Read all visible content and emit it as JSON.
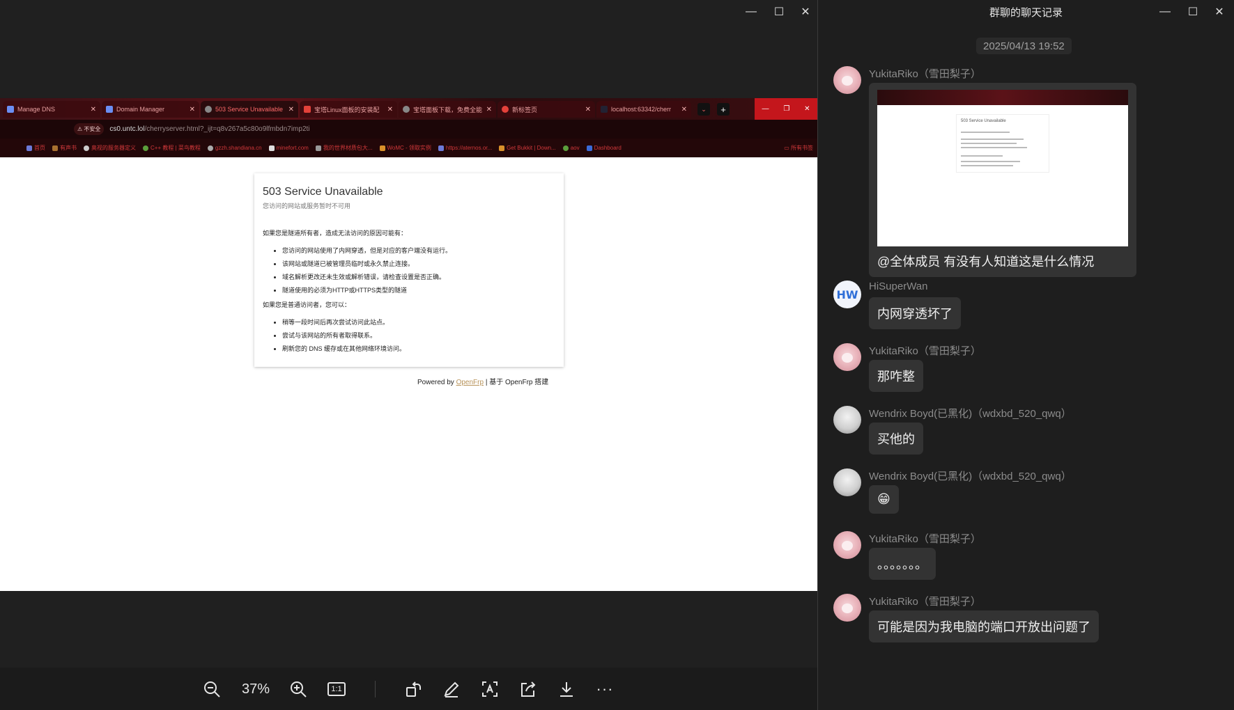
{
  "viewer": {
    "window_controls": {
      "minimize": "—",
      "maximize": "☐",
      "close": "✕"
    },
    "browser": {
      "tabs": [
        {
          "label": "Manage DNS",
          "active": false
        },
        {
          "label": "Domain Manager",
          "active": false
        },
        {
          "label": "503 Service Unavailable",
          "active": true
        },
        {
          "label": "宝塔Linux面板的安装配",
          "active": false
        },
        {
          "label": "宝塔面板下载，免费全能",
          "active": false
        },
        {
          "label": "新标签页",
          "active": false
        },
        {
          "label": "localhost:63342/cherr",
          "active": false
        }
      ],
      "security_label": "⚠ 不安全",
      "url_host": "cs0.untc.lol",
      "url_path": "/cherryserver.html?_ijt=q8v267a5c80o9lfmbdn7imp2ti",
      "bookmarks": [
        "首页",
        "有声书",
        "奥视的服务器定义",
        "C++ 教程 | 菜鸟教程",
        "gzzh.shandiana.cn",
        "minefort.com",
        "我的世界材质包大...",
        "WoMC - 领取实例",
        "https://aternos.or...",
        "Get Bukkit | Down...",
        "aov",
        "Dashboard"
      ],
      "bookmarks_all": "所有书签"
    },
    "page": {
      "title": "503 Service Unavailable",
      "subtitle": "您访问的网站或服务暂时不可用",
      "owner_intro": "如果您是隧道所有者，造成无法访问的原因可能有：",
      "owner_reasons": [
        "您访问的网站使用了内网穿透，但是对应的客户端没有运行。",
        "该网站或隧道已被管理员临时或永久禁止连接。",
        "域名解析更改还未生效或解析错误，请检查设置是否正确。",
        "隧道使用的必须为HTTP或HTTPS类型的隧道"
      ],
      "visitor_intro": "如果您是普通访问者，您可以：",
      "visitor_tips": [
        "稍等一段时间后再次尝试访问此站点。",
        "尝试与该网站的所有者取得联系。",
        "刷新您的 DNS 缓存或在其他网络环境访问。"
      ],
      "powered_prefix": "Powered by ",
      "powered_link": "OpenFrp",
      "powered_suffix": " | 基于 OpenFrp 搭建"
    },
    "toolbar": {
      "zoom_level": "37%",
      "actual_size": "1:1",
      "more": "···"
    }
  },
  "chat": {
    "title": "群聊的聊天记录",
    "window_controls": {
      "minimize": "—",
      "maximize": "☐",
      "close": "✕"
    },
    "date": "2025/04/13 19:52",
    "messages": [
      {
        "sender": "YukitaRiko（雪田梨子）",
        "avatar": "riko",
        "has_image": true,
        "text": "@全体成员 有没有人知道这是什么情况",
        "thumb_title": "503 Service Unavailable"
      },
      {
        "sender": "HiSuperWan",
        "avatar": "hs",
        "avatar_text": "HW",
        "text": "内网穿透坏了"
      },
      {
        "sender": "YukitaRiko（雪田梨子）",
        "avatar": "riko",
        "text": "那咋整"
      },
      {
        "sender": "Wendrix Boyd(已黑化)（wdxbd_520_qwq）",
        "avatar": "wb",
        "text": "买他的"
      },
      {
        "sender": "Wendrix Boyd(已黑化)（wdxbd_520_qwq）",
        "avatar": "wb",
        "text": "😁"
      },
      {
        "sender": "YukitaRiko（雪田梨子）",
        "avatar": "riko",
        "text": "。。。。。。。"
      },
      {
        "sender": "YukitaRiko（雪田梨子）",
        "avatar": "riko",
        "text": "可能是因为我电脑的端口开放出问题了"
      }
    ]
  }
}
